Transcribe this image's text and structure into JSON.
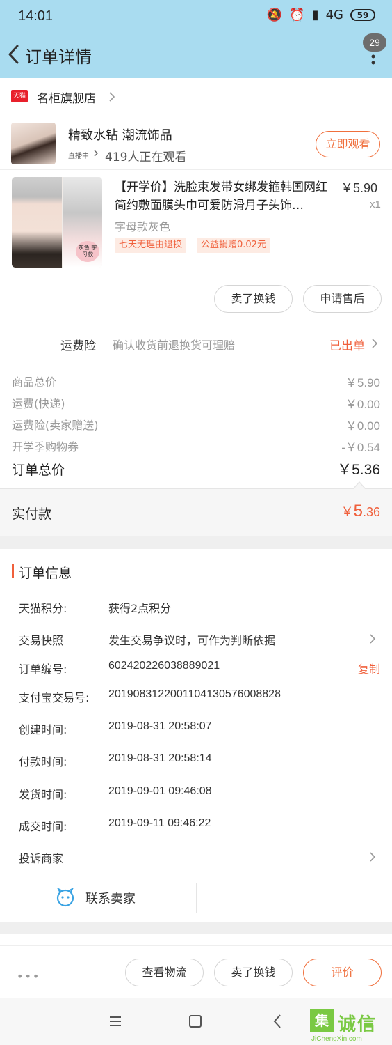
{
  "status": {
    "time": "14:01",
    "network": "4G",
    "battery": "59"
  },
  "nav": {
    "title": "订单详情",
    "badge": "29"
  },
  "shop": {
    "name": "名柜旗舰店",
    "logo_text": "天猫"
  },
  "live": {
    "title": "精致水钻 潮流饰品",
    "tag": "直播中",
    "watchers": "419人正在观看",
    "button": "立即观看"
  },
  "product": {
    "title": "【开学价】洗脸束发带女绑发箍韩国网红简约敷面膜头巾可爱防滑月子头饰…",
    "price": "￥5.90",
    "qty": "x1",
    "spec": "字母款灰色",
    "img_tag": "灰色 字母款",
    "chips": [
      "七天无理由退换",
      "公益捐赠0.02元"
    ],
    "actions": {
      "sell": "卖了换钱",
      "after_sale": "申请售后"
    }
  },
  "insurance": {
    "label": "运费险",
    "desc": "确认收货前退换货可理赔",
    "status": "已出单"
  },
  "price_rows": [
    {
      "label": "商品总价",
      "value": "￥5.90"
    },
    {
      "label": "运费(快递)",
      "value": "￥0.00"
    },
    {
      "label": "运费险(卖家赠送)",
      "value": "￥0.00"
    },
    {
      "label": "开学季购物券",
      "value": "-￥0.54"
    }
  ],
  "total": {
    "label": "订单总价",
    "value": "￥5.36"
  },
  "paid": {
    "label": "实付款",
    "currency": "￥",
    "int": "5",
    "dec": ".36"
  },
  "order_info": {
    "title": "订单信息",
    "rows": [
      {
        "key": "天猫积分:",
        "value": "获得2点积分"
      },
      {
        "key": "交易快照",
        "value": "发生交易争议时，可作为判断依据"
      },
      {
        "key": "订单编号:",
        "value": "602420226038889021"
      },
      {
        "key": "支付宝交易号:",
        "value": "2019083122001104130576008828"
      },
      {
        "key": "创建时间:",
        "value": "2019-08-31 20:58:07"
      },
      {
        "key": "付款时间:",
        "value": "2019-08-31 20:58:14"
      },
      {
        "key": "发货时间:",
        "value": "2019-09-01 09:46:08"
      },
      {
        "key": "成交时间:",
        "value": "2019-09-11 09:46:22"
      },
      {
        "key": "投诉商家",
        "value": ""
      }
    ],
    "copy": "复制"
  },
  "contact": {
    "label": "联系卖家"
  },
  "bottom_bar": {
    "dots": "•••",
    "logistics": "查看物流",
    "sell": "卖了换钱",
    "rate": "评价"
  },
  "watermark": {
    "logo": "集",
    "chars": "诚信",
    "url": "JiChengXin.com"
  },
  "colors": {
    "accent": "#f0603c",
    "header_bg": "#a9dcf0",
    "tmall_red": "#e8202b"
  }
}
